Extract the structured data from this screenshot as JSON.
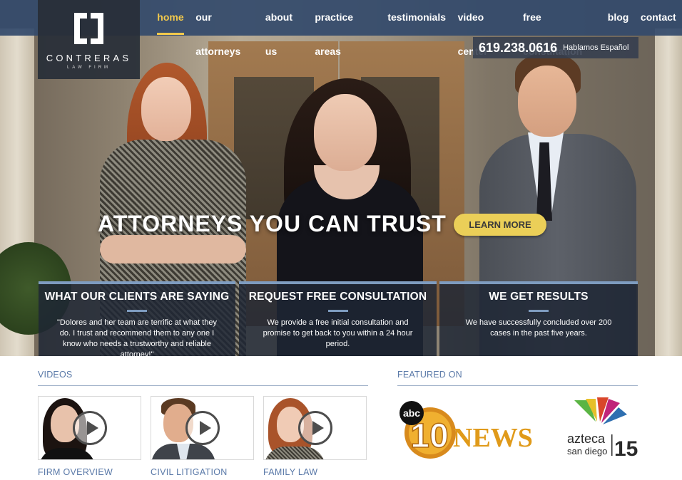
{
  "brand": {
    "name": "CONTRERAS",
    "subtitle": "LAW FIRM"
  },
  "nav": {
    "items": [
      {
        "label": "home",
        "active": true
      },
      {
        "label": "our attorneys",
        "active": false
      },
      {
        "label": "about us",
        "active": false
      },
      {
        "label": "practice areas",
        "active": false
      },
      {
        "label": "testimonials",
        "active": false
      },
      {
        "label": "video center",
        "active": false
      },
      {
        "label": "free consultation",
        "active": false
      },
      {
        "label": "blog",
        "active": false
      },
      {
        "label": "contact",
        "active": false
      }
    ]
  },
  "contact": {
    "phone": "619.238.0616",
    "spanish": "Hablamos Español"
  },
  "hero": {
    "tagline": "ATTORNEYS YOU CAN TRUST",
    "cta_label": "LEARN MORE"
  },
  "panels": [
    {
      "title": "WHAT OUR CLIENTS ARE SAYING",
      "text": "\"Dolores and her team are terrific at what they do. I trust and recommend them to any one I know who needs a trustworthy and reliable attorney!\""
    },
    {
      "title": "REQUEST FREE CONSULTATION",
      "text": "We provide a free initial consultation and promise to get back to you within a 24 hour period."
    },
    {
      "title": "WE GET RESULTS",
      "text": "We have successfully concluded over 200 cases in the past five years."
    }
  ],
  "videos": {
    "heading": "VIDEOS",
    "items": [
      {
        "label": "FIRM OVERVIEW"
      },
      {
        "label": "CIVIL LITIGATION"
      },
      {
        "label": "FAMILY LAW"
      }
    ]
  },
  "featured": {
    "heading": "FEATURED ON",
    "logos": [
      {
        "label": "abc",
        "number": "10",
        "word": "NEWS"
      },
      {
        "label": "azteca",
        "sub": "san diego",
        "number": "15"
      }
    ]
  },
  "colors": {
    "nav_bg": "#344a6c",
    "accent_yellow": "#f2c94c",
    "link_blue": "#5a79a8",
    "panel_border": "#7e9cc0"
  },
  "icons": [
    "play-icon",
    "logo-mark"
  ]
}
